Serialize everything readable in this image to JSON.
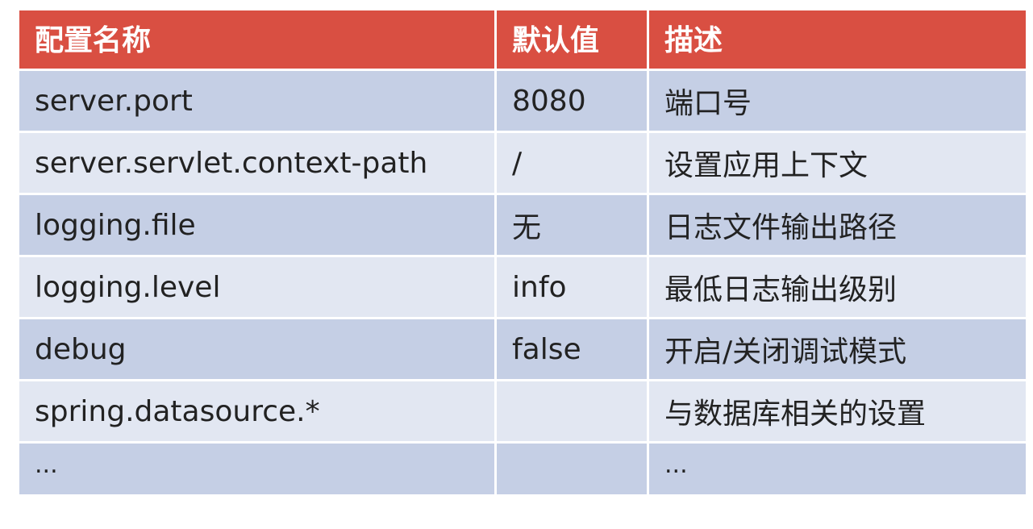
{
  "table": {
    "headers": [
      "配置名称",
      "默认值",
      "描述"
    ],
    "rows": [
      {
        "name": "server.port",
        "default": "8080",
        "description": "端口号"
      },
      {
        "name": "server.servlet.context-path",
        "default": "/",
        "description": "设置应用上下文"
      },
      {
        "name": "logging.file",
        "default": "无",
        "description": "日志文件输出路径"
      },
      {
        "name": "logging.level",
        "default": "info",
        "description": "最低日志输出级别"
      },
      {
        "name": "debug",
        "default": "false",
        "description": "开启/关闭调试模式"
      },
      {
        "name": "spring.datasource.*",
        "default": "",
        "description": "与数据库相关的设置"
      },
      {
        "name": "...",
        "default": "",
        "description": "..."
      }
    ]
  },
  "colors": {
    "header_bg": "#d94f42",
    "row_dark_bg": "#c5cfe5",
    "row_light_bg": "#e2e7f2",
    "header_text": "#ffffff",
    "body_text": "#222222"
  }
}
